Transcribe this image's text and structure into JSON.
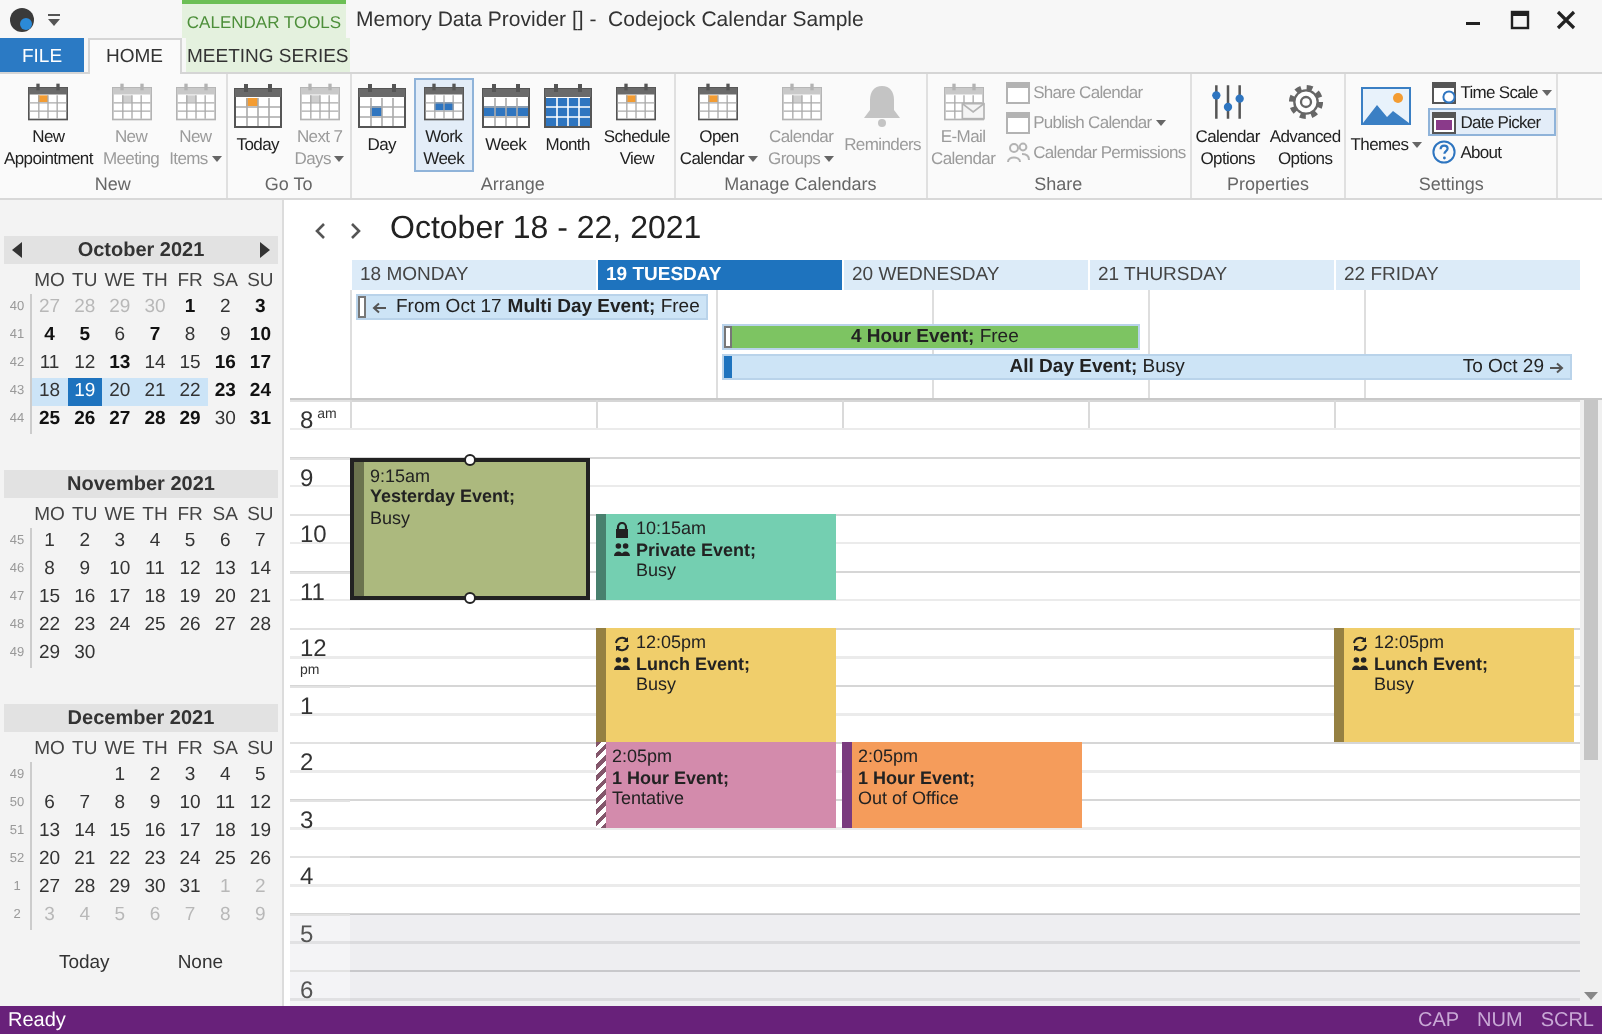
{
  "title_bar": {
    "context_tab": "CALENDAR TOOLS",
    "title": "Memory Data Provider [] -  Codejock Calendar Sample"
  },
  "tabs": [
    {
      "label": "FILE",
      "kind": "file",
      "selected": false
    },
    {
      "label": "HOME",
      "kind": "tab",
      "selected": true
    },
    {
      "label": "MEETING SERIES",
      "kind": "tab",
      "selected": false
    }
  ],
  "ribbon_groups": [
    {
      "label": "New",
      "buttons": [
        {
          "kind": "large",
          "label": [
            "New",
            "Appointment"
          ],
          "disabled": false,
          "dropdown": false,
          "selected": false
        },
        {
          "kind": "large",
          "label": [
            "New",
            "Meeting"
          ],
          "disabled": true,
          "dropdown": false,
          "selected": false
        },
        {
          "kind": "large",
          "label": [
            "New",
            "Items"
          ],
          "disabled": true,
          "dropdown": true,
          "selected": false
        }
      ]
    },
    {
      "label": "Go To",
      "buttons": [
        {
          "kind": "large",
          "label": [
            "Today"
          ],
          "disabled": false,
          "dropdown": false,
          "selected": false
        },
        {
          "kind": "large",
          "label": [
            "Next 7",
            "Days"
          ],
          "disabled": true,
          "dropdown": true,
          "selected": false
        }
      ]
    },
    {
      "label": "Arrange",
      "buttons": [
        {
          "kind": "large",
          "label": [
            "Day"
          ],
          "disabled": false,
          "dropdown": false,
          "selected": false
        },
        {
          "kind": "large",
          "label": [
            "Work",
            "Week"
          ],
          "disabled": false,
          "dropdown": false,
          "selected": true
        },
        {
          "kind": "large",
          "label": [
            "Week"
          ],
          "disabled": false,
          "dropdown": false,
          "selected": false
        },
        {
          "kind": "large",
          "label": [
            "Month"
          ],
          "disabled": false,
          "dropdown": false,
          "selected": false
        },
        {
          "kind": "large",
          "label": [
            "Schedule",
            "View"
          ],
          "disabled": false,
          "dropdown": false,
          "selected": false
        }
      ]
    },
    {
      "label": "Manage Calendars",
      "buttons": [
        {
          "kind": "large",
          "label": [
            "Open",
            "Calendar"
          ],
          "disabled": false,
          "dropdown": true,
          "selected": false
        },
        {
          "kind": "large",
          "label": [
            "Calendar",
            "Groups"
          ],
          "disabled": true,
          "dropdown": true,
          "selected": false
        },
        {
          "kind": "large",
          "label": [
            "Reminders"
          ],
          "disabled": true,
          "dropdown": false,
          "selected": false
        }
      ]
    },
    {
      "label": "Share",
      "buttons": [
        {
          "kind": "large",
          "label": [
            "E-Mail",
            "Calendar"
          ],
          "disabled": true,
          "dropdown": false,
          "selected": false
        },
        {
          "kind": "small",
          "label": [
            "Share Calendar"
          ],
          "disabled": true,
          "dropdown": false,
          "selected": false
        },
        {
          "kind": "small",
          "label": [
            "Publish Calendar"
          ],
          "disabled": true,
          "dropdown": true,
          "selected": false
        },
        {
          "kind": "small",
          "label": [
            "Calendar Permissions"
          ],
          "disabled": true,
          "dropdown": false,
          "selected": false
        }
      ]
    },
    {
      "label": "Properties",
      "buttons": [
        {
          "kind": "large",
          "label": [
            "Calendar",
            "Options"
          ],
          "disabled": false,
          "dropdown": false,
          "selected": false
        },
        {
          "kind": "large",
          "label": [
            "Advanced",
            "Options"
          ],
          "disabled": false,
          "dropdown": false,
          "selected": false
        }
      ]
    },
    {
      "label": "Settings",
      "buttons": [
        {
          "kind": "large",
          "label": [
            "Themes"
          ],
          "disabled": false,
          "dropdown": true,
          "selected": false
        },
        {
          "kind": "small",
          "label": [
            "Time Scale"
          ],
          "disabled": false,
          "dropdown": true,
          "selected": false
        },
        {
          "kind": "small",
          "label": [
            "Date Picker"
          ],
          "disabled": false,
          "dropdown": false,
          "selected": true
        },
        {
          "kind": "small",
          "label": [
            "About"
          ],
          "disabled": false,
          "dropdown": false,
          "selected": false
        }
      ]
    }
  ],
  "mini_calendars": [
    {
      "title": "October 2021",
      "navigation": true,
      "weekdays": [
        "MO",
        "TU",
        "WE",
        "TH",
        "FR",
        "SA",
        "SU"
      ],
      "weeks": [
        {
          "number": "40",
          "days": [
            {
              "day": "27",
              "kind": "other",
              "selected": false,
              "in_range": false
            },
            {
              "day": "28",
              "kind": "other",
              "selected": false,
              "in_range": false
            },
            {
              "day": "29",
              "kind": "other",
              "selected": false,
              "in_range": false
            },
            {
              "day": "30",
              "kind": "other",
              "selected": false,
              "in_range": false
            },
            {
              "day": "1",
              "kind": "bold",
              "selected": false,
              "in_range": false
            },
            {
              "day": "2",
              "kind": "plain",
              "selected": false,
              "in_range": false
            },
            {
              "day": "3",
              "kind": "bold",
              "selected": false,
              "in_range": false
            }
          ]
        },
        {
          "number": "41",
          "days": [
            {
              "day": "4",
              "kind": "bold",
              "selected": false,
              "in_range": false
            },
            {
              "day": "5",
              "kind": "bold",
              "selected": false,
              "in_range": false
            },
            {
              "day": "6",
              "kind": "plain",
              "selected": false,
              "in_range": false
            },
            {
              "day": "7",
              "kind": "bold",
              "selected": false,
              "in_range": false
            },
            {
              "day": "8",
              "kind": "plain",
              "selected": false,
              "in_range": false
            },
            {
              "day": "9",
              "kind": "plain",
              "selected": false,
              "in_range": false
            },
            {
              "day": "10",
              "kind": "bold",
              "selected": false,
              "in_range": false
            }
          ]
        },
        {
          "number": "42",
          "days": [
            {
              "day": "11",
              "kind": "plain",
              "selected": false,
              "in_range": false
            },
            {
              "day": "12",
              "kind": "plain",
              "selected": false,
              "in_range": false
            },
            {
              "day": "13",
              "kind": "bold",
              "selected": false,
              "in_range": false
            },
            {
              "day": "14",
              "kind": "plain",
              "selected": false,
              "in_range": false
            },
            {
              "day": "15",
              "kind": "plain",
              "selected": false,
              "in_range": false
            },
            {
              "day": "16",
              "kind": "bold",
              "selected": false,
              "in_range": false
            },
            {
              "day": "17",
              "kind": "bold",
              "selected": false,
              "in_range": false
            }
          ]
        },
        {
          "number": "43",
          "days": [
            {
              "day": "18",
              "kind": "plain",
              "selected": false,
              "in_range": true
            },
            {
              "day": "19",
              "kind": "plain",
              "selected": true,
              "in_range": true
            },
            {
              "day": "20",
              "kind": "plain",
              "selected": false,
              "in_range": true
            },
            {
              "day": "21",
              "kind": "plain",
              "selected": false,
              "in_range": true
            },
            {
              "day": "22",
              "kind": "plain",
              "selected": false,
              "in_range": true
            },
            {
              "day": "23",
              "kind": "bold",
              "selected": false,
              "in_range": false
            },
            {
              "day": "24",
              "kind": "bold",
              "selected": false,
              "in_range": false
            }
          ]
        },
        {
          "number": "44",
          "days": [
            {
              "day": "25",
              "kind": "bold",
              "selected": false,
              "in_range": false
            },
            {
              "day": "26",
              "kind": "bold",
              "selected": false,
              "in_range": false
            },
            {
              "day": "27",
              "kind": "bold",
              "selected": false,
              "in_range": false
            },
            {
              "day": "28",
              "kind": "bold",
              "selected": false,
              "in_range": false
            },
            {
              "day": "29",
              "kind": "bold",
              "selected": false,
              "in_range": false
            },
            {
              "day": "30",
              "kind": "plain",
              "selected": false,
              "in_range": false
            },
            {
              "day": "31",
              "kind": "bold",
              "selected": false,
              "in_range": false
            }
          ]
        }
      ]
    },
    {
      "title": "November 2021",
      "navigation": false,
      "weekdays": [
        "MO",
        "TU",
        "WE",
        "TH",
        "FR",
        "SA",
        "SU"
      ],
      "weeks": [
        {
          "number": "45",
          "days": [
            {
              "day": "1",
              "kind": "plain",
              "selected": false,
              "in_range": false
            },
            {
              "day": "2",
              "kind": "plain",
              "selected": false,
              "in_range": false
            },
            {
              "day": "3",
              "kind": "plain",
              "selected": false,
              "in_range": false
            },
            {
              "day": "4",
              "kind": "plain",
              "selected": false,
              "in_range": false
            },
            {
              "day": "5",
              "kind": "plain",
              "selected": false,
              "in_range": false
            },
            {
              "day": "6",
              "kind": "plain",
              "selected": false,
              "in_range": false
            },
            {
              "day": "7",
              "kind": "plain",
              "selected": false,
              "in_range": false
            }
          ]
        },
        {
          "number": "46",
          "days": [
            {
              "day": "8",
              "kind": "plain",
              "selected": false,
              "in_range": false
            },
            {
              "day": "9",
              "kind": "plain",
              "selected": false,
              "in_range": false
            },
            {
              "day": "10",
              "kind": "plain",
              "selected": false,
              "in_range": false
            },
            {
              "day": "11",
              "kind": "plain",
              "selected": false,
              "in_range": false
            },
            {
              "day": "12",
              "kind": "plain",
              "selected": false,
              "in_range": false
            },
            {
              "day": "13",
              "kind": "plain",
              "selected": false,
              "in_range": false
            },
            {
              "day": "14",
              "kind": "plain",
              "selected": false,
              "in_range": false
            }
          ]
        },
        {
          "number": "47",
          "days": [
            {
              "day": "15",
              "kind": "plain",
              "selected": false,
              "in_range": false
            },
            {
              "day": "16",
              "kind": "plain",
              "selected": false,
              "in_range": false
            },
            {
              "day": "17",
              "kind": "plain",
              "selected": false,
              "in_range": false
            },
            {
              "day": "18",
              "kind": "plain",
              "selected": false,
              "in_range": false
            },
            {
              "day": "19",
              "kind": "plain",
              "selected": false,
              "in_range": false
            },
            {
              "day": "20",
              "kind": "plain",
              "selected": false,
              "in_range": false
            },
            {
              "day": "21",
              "kind": "plain",
              "selected": false,
              "in_range": false
            }
          ]
        },
        {
          "number": "48",
          "days": [
            {
              "day": "22",
              "kind": "plain",
              "selected": false,
              "in_range": false
            },
            {
              "day": "23",
              "kind": "plain",
              "selected": false,
              "in_range": false
            },
            {
              "day": "24",
              "kind": "plain",
              "selected": false,
              "in_range": false
            },
            {
              "day": "25",
              "kind": "plain",
              "selected": false,
              "in_range": false
            },
            {
              "day": "26",
              "kind": "plain",
              "selected": false,
              "in_range": false
            },
            {
              "day": "27",
              "kind": "plain",
              "selected": false,
              "in_range": false
            },
            {
              "day": "28",
              "kind": "plain",
              "selected": false,
              "in_range": false
            }
          ]
        },
        {
          "number": "49",
          "days": [
            {
              "day": "29",
              "kind": "plain",
              "selected": false,
              "in_range": false
            },
            {
              "day": "30",
              "kind": "plain",
              "selected": false,
              "in_range": false
            }
          ]
        }
      ]
    },
    {
      "title": "December 2021",
      "navigation": false,
      "weekdays": [
        "MO",
        "TU",
        "WE",
        "TH",
        "FR",
        "SA",
        "SU"
      ],
      "weeks": [
        {
          "number": "49",
          "days": [
            {
              "day": "1",
              "kind": "plain",
              "selected": false,
              "in_range": false
            },
            {
              "day": "2",
              "kind": "plain",
              "selected": false,
              "in_range": false
            },
            {
              "day": "3",
              "kind": "plain",
              "selected": false,
              "in_range": false
            },
            {
              "day": "4",
              "kind": "plain",
              "selected": false,
              "in_range": false
            },
            {
              "day": "5",
              "kind": "plain",
              "selected": false,
              "in_range": false
            }
          ]
        },
        {
          "number": "50",
          "days": [
            {
              "day": "6",
              "kind": "plain",
              "selected": false,
              "in_range": false
            },
            {
              "day": "7",
              "kind": "plain",
              "selected": false,
              "in_range": false
            },
            {
              "day": "8",
              "kind": "plain",
              "selected": false,
              "in_range": false
            },
            {
              "day": "9",
              "kind": "plain",
              "selected": false,
              "in_range": false
            },
            {
              "day": "10",
              "kind": "plain",
              "selected": false,
              "in_range": false
            },
            {
              "day": "11",
              "kind": "plain",
              "selected": false,
              "in_range": false
            },
            {
              "day": "12",
              "kind": "plain",
              "selected": false,
              "in_range": false
            }
          ]
        },
        {
          "number": "51",
          "days": [
            {
              "day": "13",
              "kind": "plain",
              "selected": false,
              "in_range": false
            },
            {
              "day": "14",
              "kind": "plain",
              "selected": false,
              "in_range": false
            },
            {
              "day": "15",
              "kind": "plain",
              "selected": false,
              "in_range": false
            },
            {
              "day": "16",
              "kind": "plain",
              "selected": false,
              "in_range": false
            },
            {
              "day": "17",
              "kind": "plain",
              "selected": false,
              "in_range": false
            },
            {
              "day": "18",
              "kind": "plain",
              "selected": false,
              "in_range": false
            },
            {
              "day": "19",
              "kind": "plain",
              "selected": false,
              "in_range": false
            }
          ]
        },
        {
          "number": "52",
          "days": [
            {
              "day": "20",
              "kind": "plain",
              "selected": false,
              "in_range": false
            },
            {
              "day": "21",
              "kind": "plain",
              "selected": false,
              "in_range": false
            },
            {
              "day": "22",
              "kind": "plain",
              "selected": false,
              "in_range": false
            },
            {
              "day": "23",
              "kind": "plain",
              "selected": false,
              "in_range": false
            },
            {
              "day": "24",
              "kind": "plain",
              "selected": false,
              "in_range": false
            },
            {
              "day": "25",
              "kind": "plain",
              "selected": false,
              "in_range": false
            },
            {
              "day": "26",
              "kind": "plain",
              "selected": false,
              "in_range": false
            }
          ]
        },
        {
          "number": "1",
          "days": [
            {
              "day": "27",
              "kind": "plain",
              "selected": false,
              "in_range": false
            },
            {
              "day": "28",
              "kind": "plain",
              "selected": false,
              "in_range": false
            },
            {
              "day": "29",
              "kind": "plain",
              "selected": false,
              "in_range": false
            },
            {
              "day": "30",
              "kind": "plain",
              "selected": false,
              "in_range": false
            },
            {
              "day": "31",
              "kind": "plain",
              "selected": false,
              "in_range": false
            },
            {
              "day": "1",
              "kind": "other",
              "selected": false,
              "in_range": false
            },
            {
              "day": "2",
              "kind": "other",
              "selected": false,
              "in_range": false
            }
          ]
        },
        {
          "number": "2",
          "days": [
            {
              "day": "3",
              "kind": "other",
              "selected": false,
              "in_range": false
            },
            {
              "day": "4",
              "kind": "other",
              "selected": false,
              "in_range": false
            },
            {
              "day": "5",
              "kind": "other",
              "selected": false,
              "in_range": false
            },
            {
              "day": "6",
              "kind": "other",
              "selected": false,
              "in_range": false
            },
            {
              "day": "7",
              "kind": "other",
              "selected": false,
              "in_range": false
            },
            {
              "day": "8",
              "kind": "other",
              "selected": false,
              "in_range": false
            },
            {
              "day": "9",
              "kind": "other",
              "selected": false,
              "in_range": false
            }
          ]
        }
      ]
    }
  ],
  "date_picker_buttons": [
    "Today",
    "None"
  ],
  "calendar": {
    "title": "October 18 - 22, 2021",
    "days": [
      {
        "label": "18 MONDAY",
        "selected": false
      },
      {
        "label": "19 TUESDAY",
        "selected": true
      },
      {
        "label": "20 WEDNESDAY",
        "selected": false
      },
      {
        "label": "21 THURSDAY",
        "selected": false
      },
      {
        "label": "22 FRIDAY",
        "selected": false
      }
    ],
    "all_day_events": [
      {
        "lead": "From Oct 17",
        "title": "Multi Day Event;",
        "status": "Free",
        "kind": "free",
        "color": "#cde4f6"
      },
      {
        "title": "4 Hour Event;",
        "status": "Free",
        "kind": "free",
        "color": "#7dc462"
      },
      {
        "title": "All Day Event;",
        "status": "Busy",
        "trail": "To Oct 29",
        "kind": "busy",
        "color": "#cde4f6"
      }
    ],
    "hours": [
      {
        "hour": "8",
        "suffix": "am",
        "off_hours": false
      },
      {
        "hour": "9",
        "off_hours": false
      },
      {
        "hour": "10",
        "off_hours": false
      },
      {
        "hour": "11",
        "off_hours": false
      },
      {
        "hour": "12",
        "suffix": "pm",
        "off_hours": false
      },
      {
        "hour": "1",
        "off_hours": false
      },
      {
        "hour": "2",
        "off_hours": false
      },
      {
        "hour": "3",
        "off_hours": false
      },
      {
        "hour": "4",
        "off_hours": false
      },
      {
        "hour": "5",
        "off_hours": true
      },
      {
        "hour": "6",
        "off_hours": true
      }
    ],
    "events": [
      {
        "time": "9:15am",
        "title": "Yesterday Event;",
        "status": "Busy",
        "kind": "busy",
        "color": "#acb97e",
        "private": false,
        "recurring": false,
        "meeting": false,
        "selected": true
      },
      {
        "time": "10:15am",
        "title": "Private Event;",
        "status": "Busy",
        "kind": "busy",
        "color": "#74cfb1",
        "private": true,
        "recurring": false,
        "meeting": true,
        "selected": false
      },
      {
        "time": "12:05pm",
        "title": "Lunch Event;",
        "status": "Busy",
        "kind": "busy",
        "color": "#f0ce6b",
        "private": false,
        "recurring": true,
        "meeting": true,
        "selected": false
      },
      {
        "time": "2:05pm",
        "title": "1 Hour Event;",
        "status": "Tentative",
        "kind": "tentative",
        "color": "#d38bac",
        "private": false,
        "recurring": false,
        "meeting": false,
        "selected": false
      },
      {
        "time": "2:05pm",
        "title": "1 Hour Event;",
        "status": "Out of Office",
        "kind": "out_of_office",
        "color": "#f59c5b",
        "private": false,
        "recurring": false,
        "meeting": false,
        "selected": false
      },
      {
        "time": "12:05pm",
        "title": "Lunch Event;",
        "status": "Busy",
        "kind": "busy",
        "color": "#f0ce6b",
        "private": false,
        "recurring": true,
        "meeting": true,
        "selected": false
      }
    ]
  },
  "status_bar": {
    "text": "Ready",
    "indicators": [
      {
        "label": "CAP",
        "on": false
      },
      {
        "label": "NUM",
        "on": false
      },
      {
        "label": "SCRL",
        "on": false
      }
    ]
  }
}
